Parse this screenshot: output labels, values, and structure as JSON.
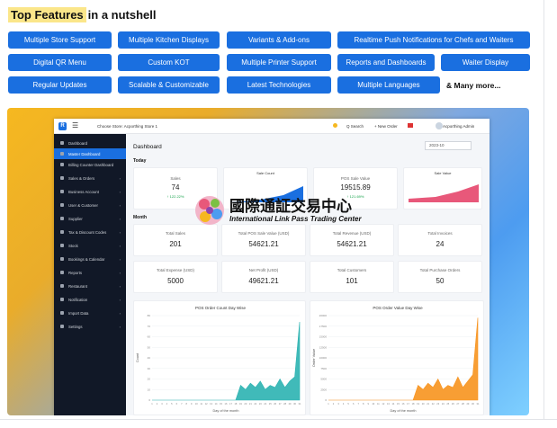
{
  "headline": {
    "highlight": "Top Features",
    "rest": " in a nutshell"
  },
  "features": [
    "Multiple Store Support",
    "Multiple Kitchen Displays",
    "Variants & Add-ons",
    "Realtime Push Notifications for Chefs and Waiters",
    "Digital QR Menu",
    "Custom KOT",
    "Multiple Printer Support",
    "Reports and Dashboards",
    "Waiter Display",
    "Regular Updates",
    "Scalable & Customizable",
    "Latest Technologies",
    "Multiple Languages"
  ],
  "more_label": "& Many more...",
  "colors": {
    "accent": "#1a6fe0",
    "highlight": "#fbe68a",
    "teal": "#2bb3b1",
    "orange": "#f7931e"
  },
  "app": {
    "logo_letter": "R",
    "store_label": "Choose Store: Acporthing Store 1",
    "search_label": "Q Search",
    "new_order_label": "+ New Order",
    "user_label": "Acporthing Admin",
    "sidebar": [
      {
        "label": "Dashboard",
        "active": false
      },
      {
        "label": "Master Dashboard",
        "active": true
      },
      {
        "label": "Billing Counter Dashboard",
        "active": false
      },
      {
        "label": "Sales & Orders",
        "active": false
      },
      {
        "label": "Business Account",
        "active": false
      },
      {
        "label": "User & Customer",
        "active": false
      },
      {
        "label": "Supplier",
        "active": false
      },
      {
        "label": "Tax & Discount Codes",
        "active": false
      },
      {
        "label": "Stock",
        "active": false
      },
      {
        "label": "Bookings & Calendar",
        "active": false
      },
      {
        "label": "Reports",
        "active": false
      },
      {
        "label": "Restaurant",
        "active": false
      },
      {
        "label": "Notification",
        "active": false
      },
      {
        "label": "Import Data",
        "active": false
      },
      {
        "label": "Settings",
        "active": false
      }
    ],
    "dashboard_title": "Dashboard",
    "date_value": "2023-10",
    "today_label": "Today",
    "month_label": "Month",
    "today_cards": [
      {
        "label": "Sales",
        "value": "74",
        "change": "↑ 122.22%"
      },
      {
        "label": "POS Sale Value",
        "value": "19515.89",
        "change": "↑ 121.69%"
      }
    ],
    "mini_charts": [
      {
        "title": "Sale Count",
        "legend": [
          "Sale Before Prev",
          "Yesterday",
          "Today"
        ]
      },
      {
        "title": "Sale Value",
        "legend": [
          "Sale Before Prev",
          "Yesterday",
          "Today"
        ]
      }
    ],
    "month_cards_row1": [
      {
        "label": "Total Sales",
        "value": "201"
      },
      {
        "label": "Total POS Sale Value (USD)",
        "value": "54621.21"
      },
      {
        "label": "Total Revenue (USD)",
        "value": "54621.21"
      },
      {
        "label": "Total Invoices",
        "value": "24"
      }
    ],
    "month_cards_row2": [
      {
        "label": "Total Expense (USD)",
        "value": "5000"
      },
      {
        "label": "Net Profit (USD)",
        "value": "49621.21"
      },
      {
        "label": "Total Customers",
        "value": "101"
      },
      {
        "label": "Total Purchase Orders",
        "value": "50"
      }
    ]
  },
  "watermark": {
    "cn": "國際通証交易中心",
    "en": "International Link Pass Trading Center"
  },
  "chart_data": [
    {
      "type": "area",
      "title": "POS Order Count Day Wise",
      "xlabel": "Day of the month",
      "ylabel": "Count",
      "ylim": [
        0,
        80
      ],
      "x": [
        1,
        2,
        3,
        4,
        5,
        6,
        7,
        8,
        9,
        10,
        11,
        12,
        13,
        14,
        15,
        16,
        17,
        18,
        19,
        20,
        21,
        22,
        23,
        24,
        25,
        26,
        27,
        28,
        29,
        30,
        31
      ],
      "series": [
        {
          "values": [
            0,
            0,
            0,
            0,
            0,
            0,
            0,
            0,
            0,
            0,
            0,
            0,
            0,
            0,
            0,
            0,
            0,
            0,
            14,
            10,
            16,
            12,
            18,
            10,
            14,
            12,
            20,
            12,
            18,
            22,
            74
          ]
        }
      ],
      "color": "#2bb3b1"
    },
    {
      "type": "area",
      "title": "POS Order Value Day Wise",
      "xlabel": "Day of the month",
      "ylabel": "Order Value",
      "ylim": [
        0,
        20000
      ],
      "x": [
        1,
        2,
        3,
        4,
        5,
        6,
        7,
        8,
        9,
        10,
        11,
        12,
        13,
        14,
        15,
        16,
        17,
        18,
        19,
        20,
        21,
        22,
        23,
        24,
        25,
        26,
        27,
        28,
        29,
        30,
        31
      ],
      "series": [
        {
          "values": [
            0,
            0,
            0,
            0,
            0,
            0,
            0,
            0,
            0,
            0,
            0,
            0,
            0,
            0,
            0,
            0,
            0,
            0,
            3500,
            2500,
            4000,
            3000,
            5000,
            2500,
            3500,
            3000,
            5500,
            3000,
            4500,
            6000,
            19500
          ]
        }
      ],
      "color": "#f7931e"
    }
  ]
}
